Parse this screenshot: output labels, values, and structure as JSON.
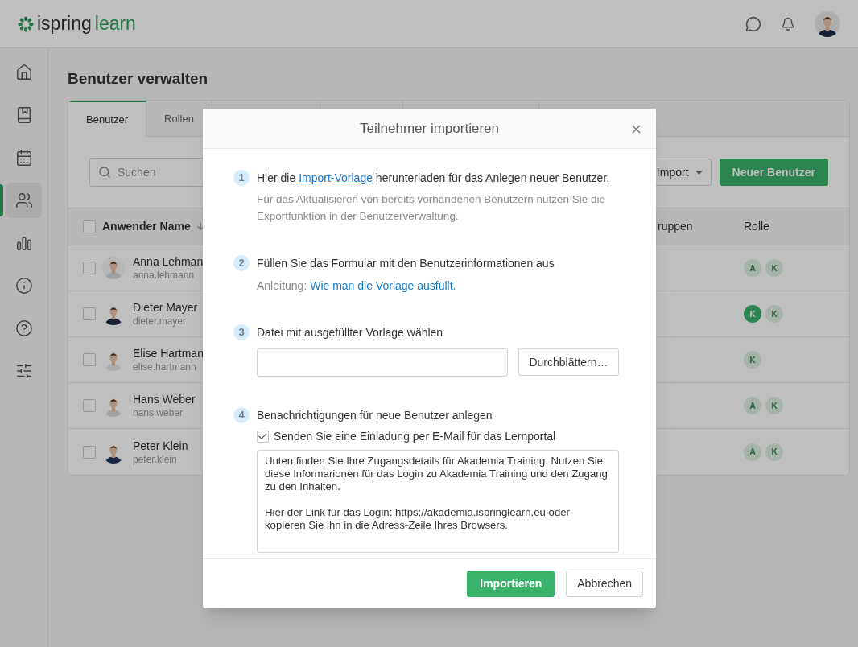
{
  "header": {
    "logo": {
      "part_1": "ispring",
      "part_2": "learn"
    }
  },
  "sidebar": {
    "items": [
      {
        "kind": "home",
        "selected": false
      },
      {
        "kind": "book",
        "selected": false
      },
      {
        "kind": "calendar",
        "selected": false
      },
      {
        "kind": "users",
        "selected": true
      },
      {
        "kind": "chart",
        "selected": false
      },
      {
        "kind": "info",
        "selected": false
      },
      {
        "kind": "help",
        "selected": false
      },
      {
        "kind": "sliders",
        "selected": false
      }
    ]
  },
  "page": {
    "title": "Benutzer verwalten"
  },
  "tabs": [
    {
      "label": "Benutzer",
      "selected": true
    },
    {
      "label": "Rollen",
      "selected": false
    }
  ],
  "toolbar": {
    "search": {
      "placeholder": "Suchen"
    },
    "import_button": "Import",
    "new_user_button": "Neuer Benutzer"
  },
  "table": {
    "select_all_checked": false,
    "columns": [
      "Anwender Name",
      "ruppen",
      "Rolle"
    ],
    "rows": [
      {
        "name": "Anna Lehman",
        "login": "anna.lehmann",
        "checked": false,
        "roles": [
          {
            "letter": "A",
            "active": false
          },
          {
            "letter": "K",
            "active": false
          }
        ]
      },
      {
        "name": "Dieter Mayer",
        "login": "dieter.mayer",
        "checked": false,
        "roles": [
          {
            "letter": "K",
            "active": true
          },
          {
            "letter": "K",
            "active": false
          }
        ]
      },
      {
        "name": "Elise Hartman",
        "login": "elise.hartmann",
        "checked": false,
        "roles": [
          {
            "letter": "K",
            "active": false
          }
        ]
      },
      {
        "name": "Hans Weber",
        "login": "hans.weber",
        "checked": false,
        "roles": [
          {
            "letter": "A",
            "active": false
          },
          {
            "letter": "K",
            "active": false
          }
        ]
      },
      {
        "name": "Peter Klein",
        "login": "peter.klein",
        "checked": false,
        "roles": [
          {
            "letter": "A",
            "active": false
          },
          {
            "letter": "K",
            "active": false
          }
        ]
      }
    ]
  },
  "dialog": {
    "title": "Teilnehmer importieren",
    "steps": [
      {
        "number": "1",
        "kind": "download",
        "text_before": "Hier die",
        "link": "Import-Vorlage",
        "text_after": "herunterladen für das Anlegen neuer Benutzer.",
        "note": "Für das Aktualisieren von bereits vorhandenen Benutzern nutzen Sie die Exportfunktion in der Benutzerverwaltung."
      },
      {
        "number": "2",
        "kind": "instructions",
        "text": "Füllen Sie das Formular mit den Benutzerinformationen aus",
        "hint_label": "Anleitung:",
        "link": "Wie man die Vorlage ausfüllt."
      },
      {
        "number": "3",
        "kind": "file",
        "text": "Datei mit ausgefüllter Vorlage wählen",
        "browse_button": "Durchblättern…"
      },
      {
        "number": "4",
        "kind": "notify",
        "text": "Benachrichtigungen für neue Benutzer anlegen",
        "checkbox": {
          "label": "Senden Sie eine Einladung per E-Mail für das Lernportal",
          "checked": true
        },
        "message": "Unten finden Sie Ihre Zugangsdetails für Akademia Training. Nutzen Sie diese Informarionen für das Login zu Akademia Training und den Zugang zu den Inhalten.\n\nHier der Link für das Login: https://akademia.ispringlearn.eu oder kopieren Sie ihn in die Adress-Zeile Ihres Browsers."
      }
    ],
    "buttons": {
      "confirm": "Importieren",
      "cancel": "Abbrechen"
    }
  }
}
